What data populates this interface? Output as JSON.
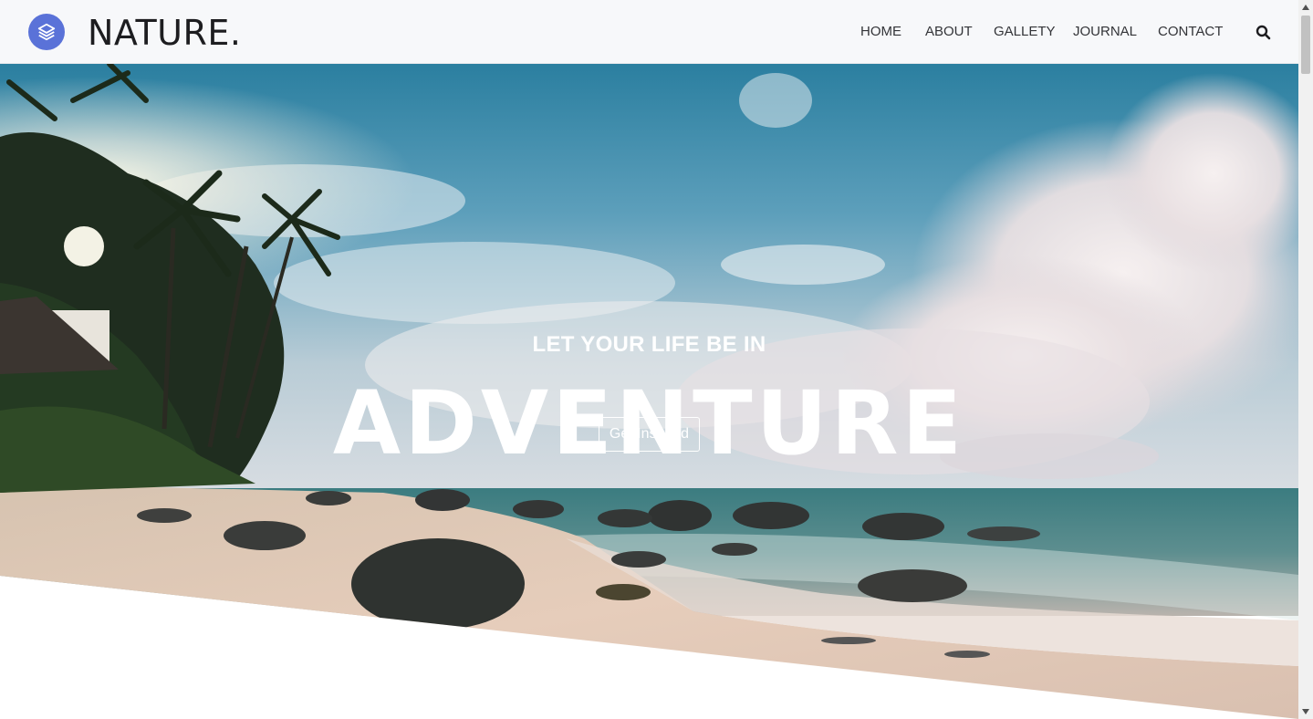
{
  "brand": {
    "name": "NATURE.",
    "logo_icon": "layers-icon",
    "accent": "#5a72d8"
  },
  "nav": {
    "items": [
      {
        "label": "HOME"
      },
      {
        "label": "ABOUT"
      },
      {
        "label": "GALLETY"
      },
      {
        "label": "JOURNAL"
      },
      {
        "label": "CONTACT"
      }
    ],
    "search_icon": "search-icon"
  },
  "hero": {
    "subtitle": "LET YOUR LIFE BE IN",
    "title": "ADVENTURE",
    "button_label": "Get Inspired"
  }
}
